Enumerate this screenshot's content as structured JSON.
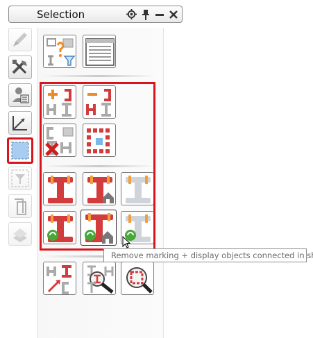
{
  "window": {
    "title": "Selection"
  },
  "title_icons": [
    "gear-icon",
    "pin-icon",
    "minimize-icon",
    "close-icon"
  ],
  "left_tools": [
    {
      "name": "pen-tool-icon"
    },
    {
      "name": "tools-icon"
    },
    {
      "name": "user-card-icon"
    },
    {
      "name": "axes-icon"
    },
    {
      "name": "selection-box-icon",
      "selected": true
    },
    {
      "name": "filter-icon"
    },
    {
      "name": "copy-icon"
    },
    {
      "name": "layers-icon"
    }
  ],
  "tooltip": {
    "text": "Remove marking + display objects connected in shop"
  },
  "colors": {
    "highlight": "#d9141b",
    "accent_orange": "#f08a24",
    "accent_red": "#d23c3c",
    "accent_blue": "#7ab8e8",
    "accent_green": "#46a836"
  }
}
